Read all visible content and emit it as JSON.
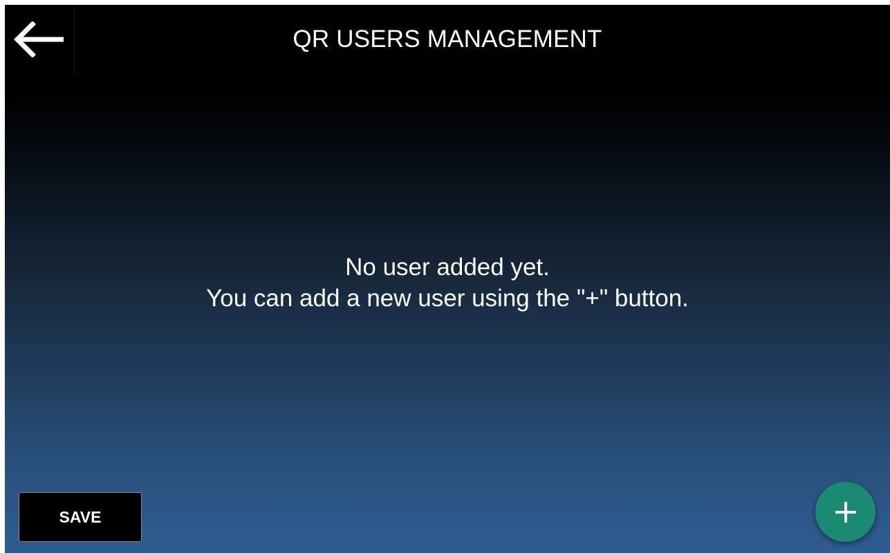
{
  "header": {
    "title": "QR USERS MANAGEMENT",
    "back_icon": "arrow-left-icon"
  },
  "empty_state": {
    "line1": "No user added yet.",
    "line2": "You can add a new user using the \"+\" button."
  },
  "footer": {
    "save_label": "SAVE",
    "add_icon": "plus-icon"
  },
  "colors": {
    "background_top": "#000000",
    "background_bottom": "#2f5c91",
    "fab": "#1a8a72",
    "text": "#ffffff"
  }
}
